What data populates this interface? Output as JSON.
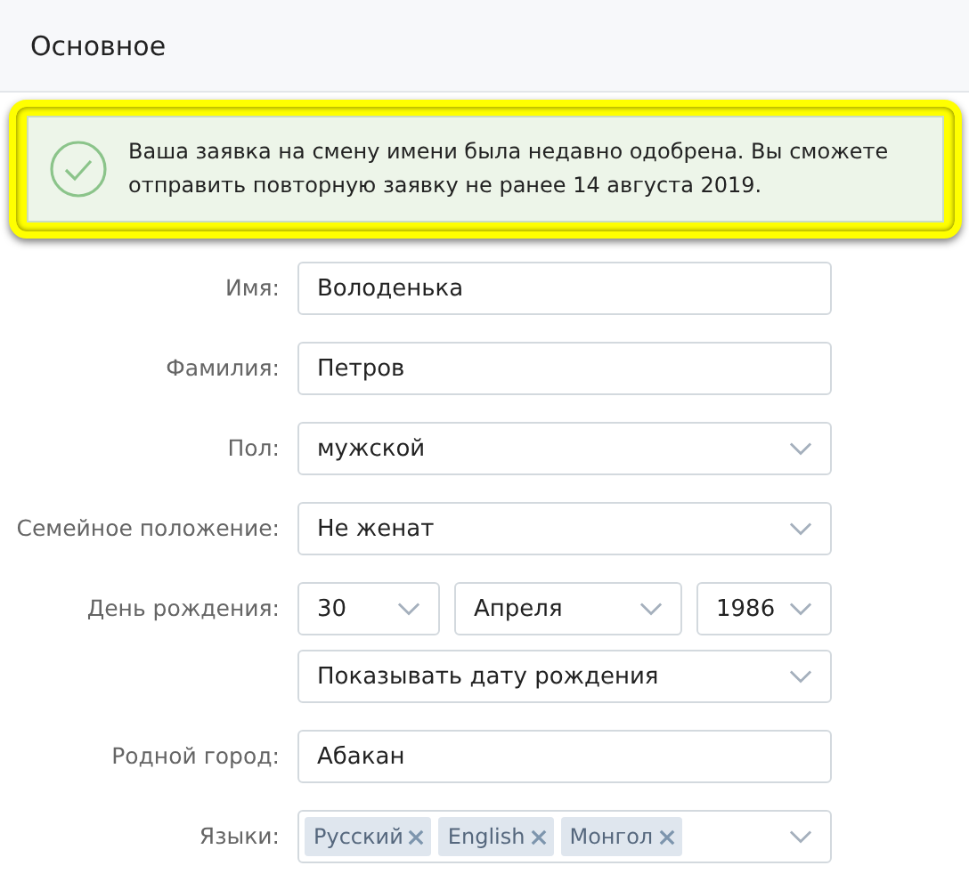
{
  "section": {
    "title": "Основное"
  },
  "notice": {
    "kind": "success",
    "text": "Ваша заявка на смену имени была недавно одобрена. Вы сможете отправить повторную заявку не ранее 14 августа 2019.",
    "highlighted": true
  },
  "fields": [
    {
      "kind": "text",
      "label": "Имя:",
      "value": "Володенька"
    },
    {
      "kind": "text",
      "label": "Фамилия:",
      "value": "Петров"
    },
    {
      "kind": "select",
      "label": "Пол:",
      "value": "мужской"
    },
    {
      "kind": "select",
      "label": "Семейное положение:",
      "value": "Не женат"
    },
    {
      "kind": "date",
      "label": "День рождения:",
      "day": "30",
      "month": "Апреля",
      "year": "1986",
      "visibility": "Показывать дату рождения"
    },
    {
      "kind": "text",
      "label": "Родной город:",
      "value": "Абакан"
    },
    {
      "kind": "tags",
      "label": "Языки:",
      "tags": [
        "Русский",
        "English",
        "Монгол"
      ]
    }
  ]
}
